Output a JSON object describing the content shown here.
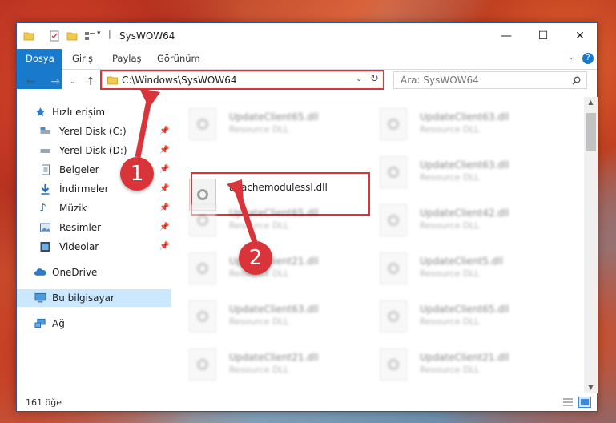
{
  "window": {
    "title": "SysWOW64",
    "controls": {
      "minimize": "—",
      "maximize": "☐",
      "close": "✕"
    }
  },
  "ribbon": {
    "tabs": [
      "Dosya",
      "Giriş",
      "Paylaş",
      "Görünüm"
    ]
  },
  "address": {
    "path": "C:\\Windows\\SysWOW64",
    "search_placeholder": "Ara: SysWOW64"
  },
  "sidebar": {
    "items": [
      {
        "label": "Hızlı erişim",
        "icon": "star-icon"
      },
      {
        "label": "Yerel Disk (C:)",
        "icon": "drive-icon",
        "pinned": true
      },
      {
        "label": "Yerel Disk (D:)",
        "icon": "drive-icon",
        "pinned": true
      },
      {
        "label": "Belgeler",
        "icon": "documents-icon",
        "pinned": true
      },
      {
        "label": "İndirmeler",
        "icon": "download-icon",
        "pinned": true
      },
      {
        "label": "Müzik",
        "icon": "music-icon",
        "pinned": true
      },
      {
        "label": "Resimler",
        "icon": "pictures-icon",
        "pinned": true
      },
      {
        "label": "Videolar",
        "icon": "videos-icon",
        "pinned": true
      },
      {
        "label": "OneDrive",
        "icon": "cloud-icon"
      },
      {
        "label": "Bu bilgisayar",
        "icon": "computer-icon",
        "selected": true
      },
      {
        "label": "Ağ",
        "icon": "network-icon"
      }
    ]
  },
  "files": [
    {
      "name": "UpdateClient65.dll",
      "type": "Resource DLL",
      "blurred": true
    },
    {
      "name": "UpdateClient63.dll",
      "type": "Resource DLL",
      "blurred": true
    },
    {
      "name": "apachemodulessl.dll",
      "type": "",
      "blurred": false
    },
    {
      "name": "UpdateClient63.dll",
      "type": "Resource DLL",
      "blurred": true
    },
    {
      "name": "UpdateClient65.dll",
      "type": "Resource DLL",
      "blurred": true
    },
    {
      "name": "UpdateClient42.dll",
      "type": "Resource DLL",
      "blurred": true
    },
    {
      "name": "UpdateClient21.dll",
      "type": "Resource DLL",
      "blurred": true
    },
    {
      "name": "UpdateClient5.dll",
      "type": "Resource DLL",
      "blurred": true
    },
    {
      "name": "UpdateClient63.dll",
      "type": "Resource DLL",
      "blurred": true
    },
    {
      "name": "UpdateClient65.dll",
      "type": "Resource DLL",
      "blurred": true
    },
    {
      "name": "UpdateClient21.dll",
      "type": "Resource DLL",
      "blurred": true
    },
    {
      "name": "UpdateClient21.dll",
      "type": "Resource DLL",
      "blurred": true
    }
  ],
  "status": {
    "count": "161 öğe"
  },
  "callouts": [
    "1",
    "2"
  ],
  "colors": {
    "accent": "#1979ca",
    "highlight": "#d9343a",
    "selected": "#cce8ff"
  }
}
